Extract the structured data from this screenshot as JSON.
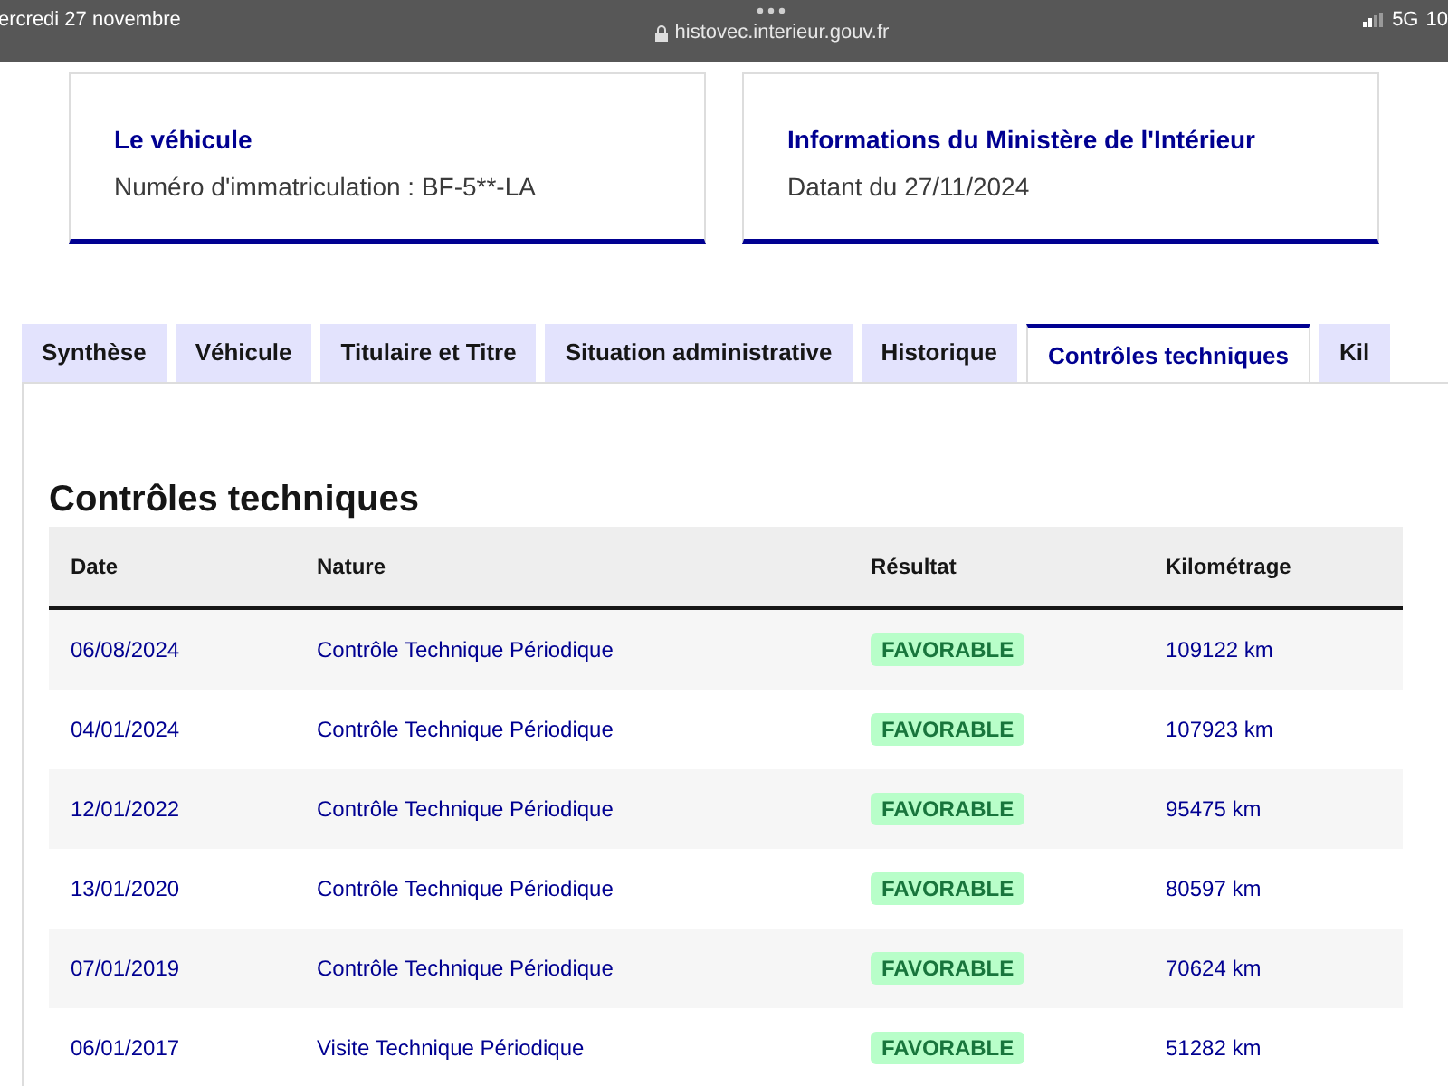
{
  "status_bar": {
    "date": "ercredi 27 novembre",
    "url": "histovec.interieur.gouv.fr",
    "network": "5G",
    "battery": "10"
  },
  "cards": [
    {
      "title": "Le véhicule",
      "text": "Numéro d'immatriculation : BF-5**-LA"
    },
    {
      "title": "Informations du Ministère de l'Intérieur",
      "text": "Datant du 27/11/2024"
    }
  ],
  "tabs": [
    {
      "label": "Synthèse",
      "selected": false
    },
    {
      "label": "Véhicule",
      "selected": false
    },
    {
      "label": "Titulaire et Titre",
      "selected": false
    },
    {
      "label": "Situation administrative",
      "selected": false
    },
    {
      "label": "Historique",
      "selected": false
    },
    {
      "label": "Contrôles techniques",
      "selected": true
    },
    {
      "label": "Kil",
      "selected": false
    }
  ],
  "section_title": "Contrôles techniques",
  "table": {
    "columns": [
      "Date",
      "Nature",
      "Résultat",
      "Kilométrage"
    ],
    "rows": [
      {
        "date": "06/08/2024",
        "nature": "Contrôle Technique Périodique",
        "result": "FAVORABLE",
        "km": "109122 km"
      },
      {
        "date": "04/01/2024",
        "nature": "Contrôle Technique Périodique",
        "result": "FAVORABLE",
        "km": "107923 km"
      },
      {
        "date": "12/01/2022",
        "nature": "Contrôle Technique Périodique",
        "result": "FAVORABLE",
        "km": "95475 km"
      },
      {
        "date": "13/01/2020",
        "nature": "Contrôle Technique Périodique",
        "result": "FAVORABLE",
        "km": "80597 km"
      },
      {
        "date": "07/01/2019",
        "nature": "Contrôle Technique Périodique",
        "result": "FAVORABLE",
        "km": "70624 km"
      },
      {
        "date": "06/01/2017",
        "nature": "Visite Technique Périodique",
        "result": "FAVORABLE",
        "km": "51282 km"
      }
    ]
  }
}
